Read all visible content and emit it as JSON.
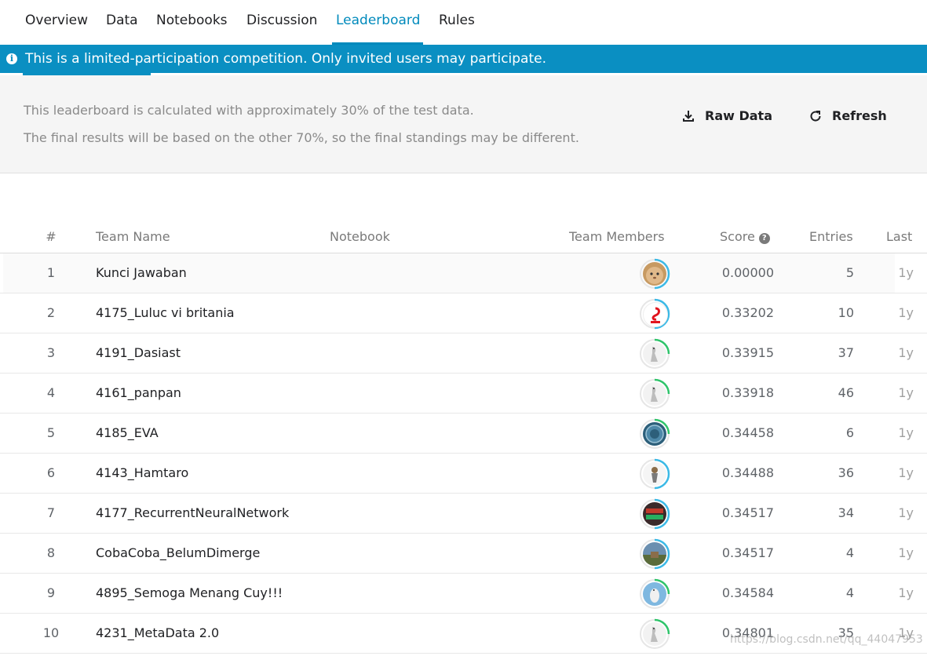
{
  "tabs": [
    {
      "label": "Overview"
    },
    {
      "label": "Data"
    },
    {
      "label": "Notebooks"
    },
    {
      "label": "Discussion"
    },
    {
      "label": "Leaderboard"
    },
    {
      "label": "Rules"
    }
  ],
  "active_tab": "Leaderboard",
  "banner": {
    "text": "This is a limited-participation competition. Only invited users may participate.",
    "icon": "info-icon",
    "color": "#0a8fc2"
  },
  "info": {
    "line1": "This leaderboard is calculated with approximately 30% of the test data.",
    "line2": "The final results will be based on the other 70%, so the final standings may be different."
  },
  "actions": {
    "raw_data": "Raw Data",
    "refresh": "Refresh"
  },
  "table": {
    "headers": {
      "rank": "#",
      "team": "Team Name",
      "notebook": "Notebook",
      "members": "Team Members",
      "score": "Score",
      "entries": "Entries",
      "last": "Last"
    },
    "rows": [
      {
        "rank": "1",
        "team": "Kunci Jawaban",
        "score": "0.00000",
        "entries": "5",
        "last": "1y",
        "avatar": "hamster-avatar",
        "ring": "#3bb9e6"
      },
      {
        "rank": "2",
        "team": "4175_Luluc vi britania",
        "score": "0.33202",
        "entries": "10",
        "last": "1y",
        "avatar": "airtel-logo-avatar",
        "ring": "#3bb9e6"
      },
      {
        "rank": "3",
        "team": "4191_Dasiast",
        "score": "0.33915",
        "entries": "37",
        "last": "1y",
        "avatar": "goose-avatar",
        "ring": "#2fc46b"
      },
      {
        "rank": "4",
        "team": "4161_panpan",
        "score": "0.33918",
        "entries": "46",
        "last": "1y",
        "avatar": "goose-avatar",
        "ring": "#2fc46b"
      },
      {
        "rank": "5",
        "team": "4185_EVA",
        "score": "0.34458",
        "entries": "6",
        "last": "1y",
        "avatar": "seal-avatar",
        "ring": "#2fc46b"
      },
      {
        "rank": "6",
        "team": "4143_Hamtaro",
        "score": "0.34488",
        "entries": "36",
        "last": "1y",
        "avatar": "figure-avatar",
        "ring": "#3bb9e6"
      },
      {
        "rank": "7",
        "team": "4177_RecurrentNeuralNetwork",
        "score": "0.34517",
        "entries": "34",
        "last": "1y",
        "avatar": "sign-avatar",
        "ring": "#3bb9e6"
      },
      {
        "rank": "8",
        "team": "CobaCoba_BelumDimerge",
        "score": "0.34517",
        "entries": "4",
        "last": "1y",
        "avatar": "landscape-avatar",
        "ring": "#3bb9e6"
      },
      {
        "rank": "9",
        "team": "4895_Semoga Menang Cuy!!!",
        "score": "0.34584",
        "entries": "4",
        "last": "1y",
        "avatar": "bird-avatar",
        "ring": "#2fc46b"
      },
      {
        "rank": "10",
        "team": "4231_MetaData 2.0",
        "score": "0.34801",
        "entries": "35",
        "last": "1y",
        "avatar": "goose-avatar",
        "ring": "#2fc46b"
      }
    ]
  },
  "watermark": "https://blog.csdn.net/qq_44047953"
}
